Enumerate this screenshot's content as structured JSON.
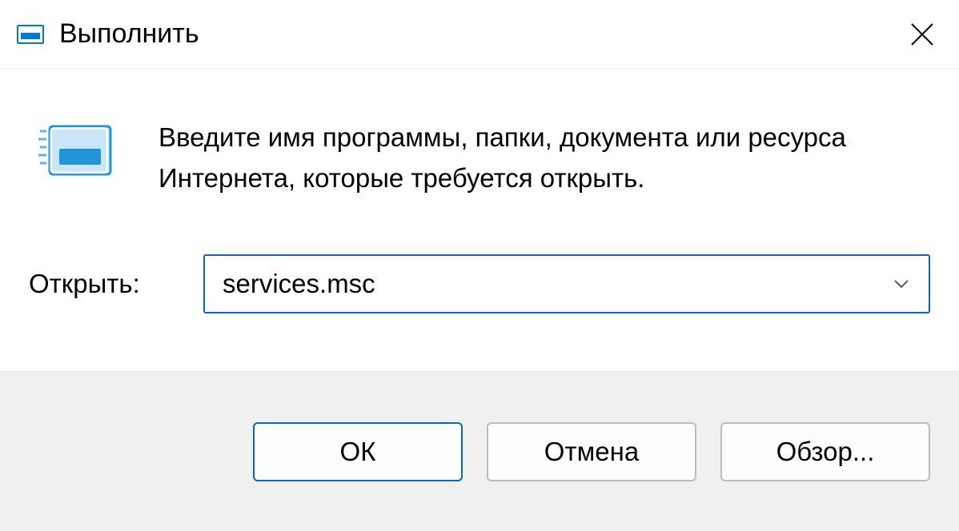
{
  "titlebar": {
    "title": "Выполнить"
  },
  "content": {
    "description": "Введите имя программы, папки, документа или ресурса Интернета, которые требуется открыть.",
    "open_label": "Открыть:",
    "input_value": "services.msc"
  },
  "footer": {
    "ok_label": "ОК",
    "cancel_label": "Отмена",
    "browse_label": "Обзор..."
  }
}
